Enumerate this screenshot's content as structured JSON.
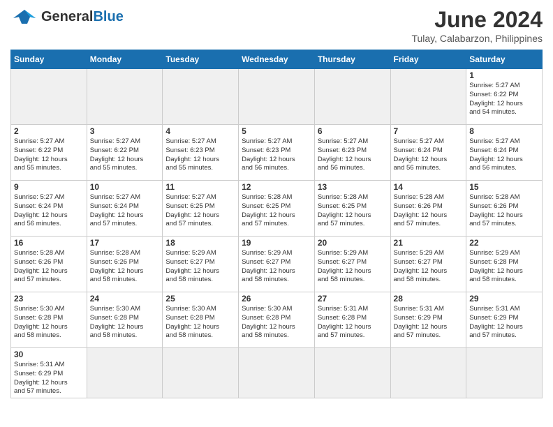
{
  "header": {
    "logo_general": "General",
    "logo_blue": "Blue",
    "month_year": "June 2024",
    "location": "Tulay, Calabarzon, Philippines"
  },
  "weekdays": [
    "Sunday",
    "Monday",
    "Tuesday",
    "Wednesday",
    "Thursday",
    "Friday",
    "Saturday"
  ],
  "days": {
    "1": {
      "sunrise": "5:27 AM",
      "sunset": "6:22 PM",
      "daylight": "12 hours and 54 minutes."
    },
    "2": {
      "sunrise": "5:27 AM",
      "sunset": "6:22 PM",
      "daylight": "12 hours and 55 minutes."
    },
    "3": {
      "sunrise": "5:27 AM",
      "sunset": "6:22 PM",
      "daylight": "12 hours and 55 minutes."
    },
    "4": {
      "sunrise": "5:27 AM",
      "sunset": "6:23 PM",
      "daylight": "12 hours and 55 minutes."
    },
    "5": {
      "sunrise": "5:27 AM",
      "sunset": "6:23 PM",
      "daylight": "12 hours and 56 minutes."
    },
    "6": {
      "sunrise": "5:27 AM",
      "sunset": "6:23 PM",
      "daylight": "12 hours and 56 minutes."
    },
    "7": {
      "sunrise": "5:27 AM",
      "sunset": "6:24 PM",
      "daylight": "12 hours and 56 minutes."
    },
    "8": {
      "sunrise": "5:27 AM",
      "sunset": "6:24 PM",
      "daylight": "12 hours and 56 minutes."
    },
    "9": {
      "sunrise": "5:27 AM",
      "sunset": "6:24 PM",
      "daylight": "12 hours and 56 minutes."
    },
    "10": {
      "sunrise": "5:27 AM",
      "sunset": "6:24 PM",
      "daylight": "12 hours and 57 minutes."
    },
    "11": {
      "sunrise": "5:27 AM",
      "sunset": "6:25 PM",
      "daylight": "12 hours and 57 minutes."
    },
    "12": {
      "sunrise": "5:28 AM",
      "sunset": "6:25 PM",
      "daylight": "12 hours and 57 minutes."
    },
    "13": {
      "sunrise": "5:28 AM",
      "sunset": "6:25 PM",
      "daylight": "12 hours and 57 minutes."
    },
    "14": {
      "sunrise": "5:28 AM",
      "sunset": "6:26 PM",
      "daylight": "12 hours and 57 minutes."
    },
    "15": {
      "sunrise": "5:28 AM",
      "sunset": "6:26 PM",
      "daylight": "12 hours and 57 minutes."
    },
    "16": {
      "sunrise": "5:28 AM",
      "sunset": "6:26 PM",
      "daylight": "12 hours and 57 minutes."
    },
    "17": {
      "sunrise": "5:28 AM",
      "sunset": "6:26 PM",
      "daylight": "12 hours and 58 minutes."
    },
    "18": {
      "sunrise": "5:29 AM",
      "sunset": "6:27 PM",
      "daylight": "12 hours and 58 minutes."
    },
    "19": {
      "sunrise": "5:29 AM",
      "sunset": "6:27 PM",
      "daylight": "12 hours and 58 minutes."
    },
    "20": {
      "sunrise": "5:29 AM",
      "sunset": "6:27 PM",
      "daylight": "12 hours and 58 minutes."
    },
    "21": {
      "sunrise": "5:29 AM",
      "sunset": "6:27 PM",
      "daylight": "12 hours and 58 minutes."
    },
    "22": {
      "sunrise": "5:29 AM",
      "sunset": "6:28 PM",
      "daylight": "12 hours and 58 minutes."
    },
    "23": {
      "sunrise": "5:30 AM",
      "sunset": "6:28 PM",
      "daylight": "12 hours and 58 minutes."
    },
    "24": {
      "sunrise": "5:30 AM",
      "sunset": "6:28 PM",
      "daylight": "12 hours and 58 minutes."
    },
    "25": {
      "sunrise": "5:30 AM",
      "sunset": "6:28 PM",
      "daylight": "12 hours and 58 minutes."
    },
    "26": {
      "sunrise": "5:30 AM",
      "sunset": "6:28 PM",
      "daylight": "12 hours and 58 minutes."
    },
    "27": {
      "sunrise": "5:31 AM",
      "sunset": "6:28 PM",
      "daylight": "12 hours and 57 minutes."
    },
    "28": {
      "sunrise": "5:31 AM",
      "sunset": "6:29 PM",
      "daylight": "12 hours and 57 minutes."
    },
    "29": {
      "sunrise": "5:31 AM",
      "sunset": "6:29 PM",
      "daylight": "12 hours and 57 minutes."
    },
    "30": {
      "sunrise": "5:31 AM",
      "sunset": "6:29 PM",
      "daylight": "12 hours and 57 minutes."
    }
  }
}
